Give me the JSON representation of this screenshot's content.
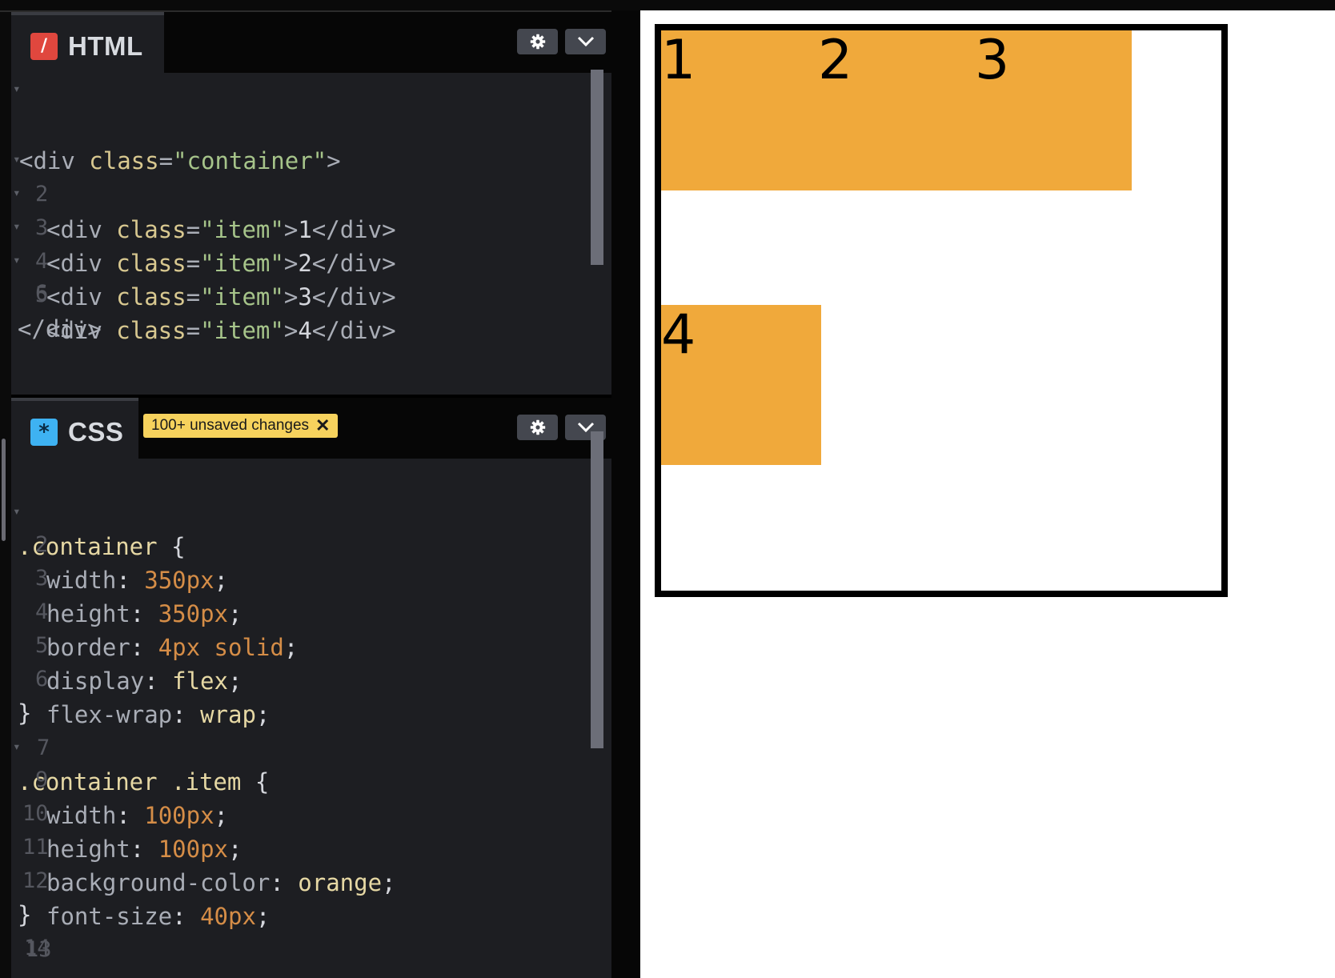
{
  "html_editor": {
    "title": "HTML",
    "icon": "html-logo-icon",
    "lines": [
      {
        "tag": "<div",
        "attr": " class",
        "eq": "=",
        "val": "\"container\"",
        "close": ">",
        "content": "",
        "end": ""
      },
      {
        "tag": "<div",
        "attr": " class",
        "eq": "=",
        "val": "\"item\"",
        "close": ">",
        "content": "1",
        "end": "</div>"
      },
      {
        "tag": "<div",
        "attr": " class",
        "eq": "=",
        "val": "\"item\"",
        "close": ">",
        "content": "2",
        "end": "</div>"
      },
      {
        "tag": "<div",
        "attr": " class",
        "eq": "=",
        "val": "\"item\"",
        "close": ">",
        "content": "3",
        "end": "</div>"
      },
      {
        "tag": "<div",
        "attr": " class",
        "eq": "=",
        "val": "\"item\"",
        "close": ">",
        "content": "4",
        "end": "</div>"
      },
      {
        "tag": "</div>",
        "attr": "",
        "eq": "",
        "val": "",
        "close": "",
        "content": "",
        "end": ""
      }
    ],
    "line_numbers": [
      "",
      "2",
      "3",
      "4",
      "5",
      "6"
    ]
  },
  "css_editor": {
    "title": "CSS",
    "icon": "css-logo-icon",
    "badge": "100+ unsaved changes",
    "line_numbers": [
      "",
      "2",
      "3",
      "4",
      "5",
      "6",
      "7",
      "8",
      "9",
      "10",
      "11",
      "12",
      "13",
      "14"
    ],
    "rule1": {
      "selector": ".container",
      "open": " {",
      "decls": [
        {
          "prop": "width",
          "value": "350px"
        },
        {
          "prop": "height",
          "value": "350px"
        },
        {
          "prop": "border",
          "value": "4px solid"
        },
        {
          "prop": "display",
          "value": "flex"
        },
        {
          "prop": "flex-wrap",
          "value": "wrap"
        }
      ]
    },
    "rule2": {
      "selector": ".container .item",
      "open": " {",
      "decls": [
        {
          "prop": "width",
          "value": "100px"
        },
        {
          "prop": "height",
          "value": "100px"
        },
        {
          "prop": "background-color",
          "value": "orange"
        },
        {
          "prop": "font-size",
          "value": "40px"
        }
      ]
    },
    "close": "}"
  },
  "preview": {
    "items": [
      "1",
      "2",
      "3",
      "4"
    ],
    "item_color": "#f0a93b",
    "border_color": "#000000"
  },
  "colors": {
    "editor_bg": "#1d1e22",
    "header_bg": "#060606",
    "badge_bg": "#f6d25d"
  }
}
